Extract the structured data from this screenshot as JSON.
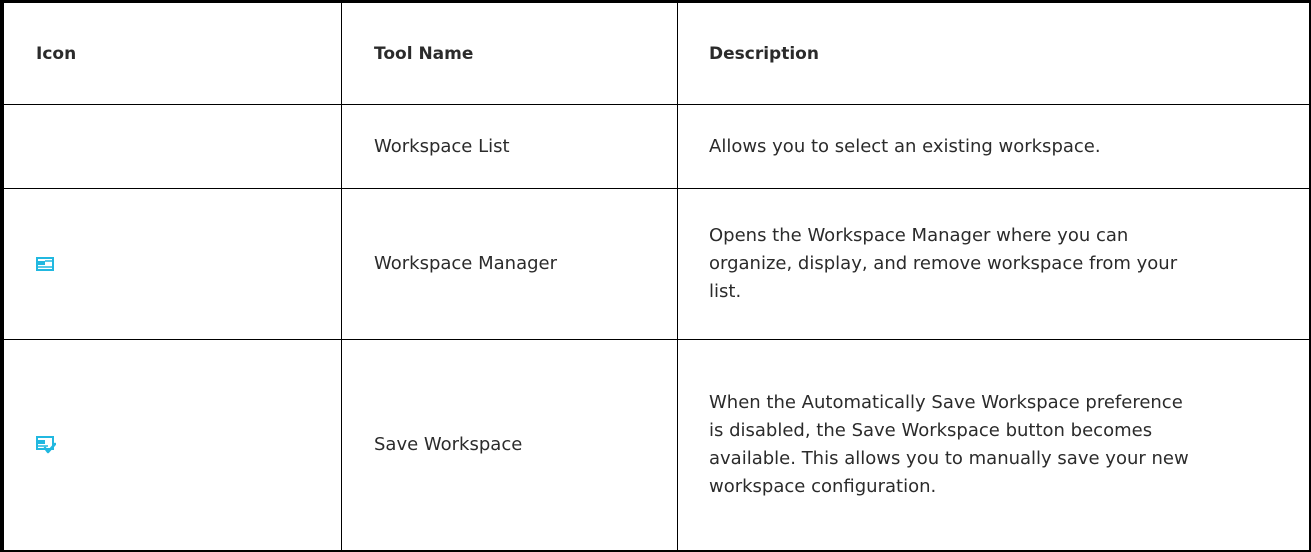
{
  "table": {
    "headers": {
      "icon": "Icon",
      "tool_name": "Tool Name",
      "description": "Description"
    },
    "rows": [
      {
        "icon": "",
        "tool_name": "Workspace List",
        "description": "Allows you to select an existing workspace."
      },
      {
        "icon": "workspace-manager-icon",
        "tool_name": "Workspace Manager",
        "description": "Opens the Workspace Manager where you can\norganize, display, and remove workspace from your\nlist."
      },
      {
        "icon": "save-workspace-icon",
        "tool_name": "Save Workspace",
        "description": "When the Automatically Save Workspace preference\nis disabled, the Save Workspace button becomes\navailable. This allows you to manually save your new\nworkspace configuration."
      }
    ]
  },
  "colors": {
    "icon_accent": "#21b8e0",
    "border": "#000000",
    "text": "#2b2b2b"
  }
}
